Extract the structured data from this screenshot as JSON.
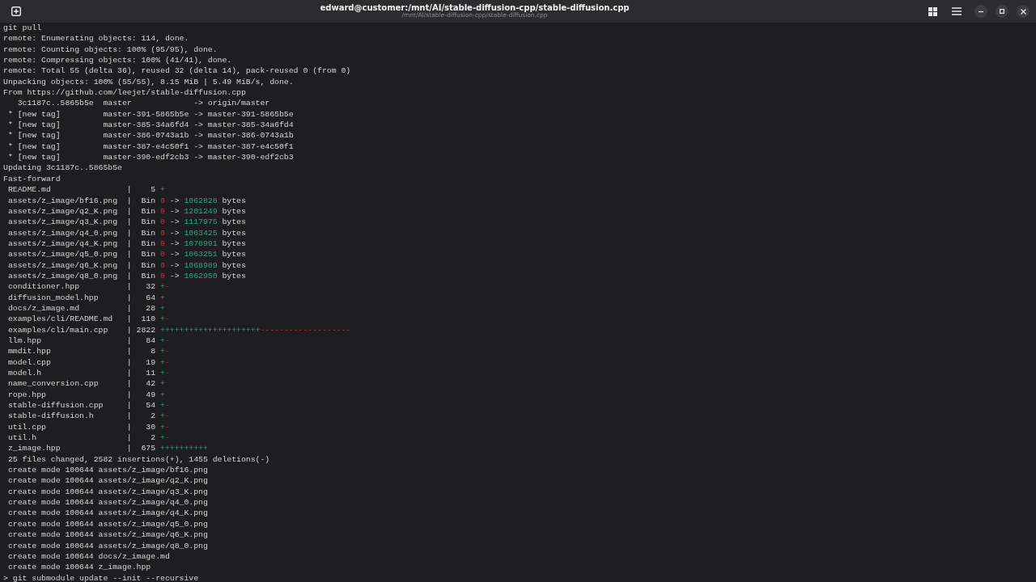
{
  "window": {
    "title": "edward@customer:/mnt/AI/stable-diffusion-cpp/stable-diffusion.cpp",
    "subtitle": "/mnt/AI/stable-diffusion-cpp/stable-diffusion.cpp"
  },
  "lines": [
    {
      "kind": "text",
      "text": "git pull"
    },
    {
      "kind": "text",
      "text": "remote: Enumerating objects: 114, done."
    },
    {
      "kind": "text",
      "text": "remote: Counting objects: 100% (95/95), done."
    },
    {
      "kind": "text",
      "text": "remote: Compressing objects: 100% (41/41), done."
    },
    {
      "kind": "text",
      "text": "remote: Total 55 (delta 36), reused 32 (delta 14), pack-reused 0 (from 0)"
    },
    {
      "kind": "text",
      "text": "Unpacking objects: 100% (55/55), 8.15 MiB | 5.49 MiB/s, done."
    },
    {
      "kind": "text",
      "text": "From https://github.com/leejet/stable-diffusion.cpp"
    },
    {
      "kind": "text",
      "text": "   3c1187c..5865b5e  master             -> origin/master"
    },
    {
      "kind": "text",
      "text": " * [new tag]         master-391-5865b5e -> master-391-5865b5e"
    },
    {
      "kind": "text",
      "text": " * [new tag]         master-385-34a6fd4 -> master-385-34a6fd4"
    },
    {
      "kind": "text",
      "text": " * [new tag]         master-386-0743a1b -> master-386-0743a1b"
    },
    {
      "kind": "text",
      "text": " * [new tag]         master-387-e4c50f1 -> master-387-e4c50f1"
    },
    {
      "kind": "text",
      "text": " * [new tag]         master-390-edf2cb3 -> master-390-edf2cb3"
    },
    {
      "kind": "text",
      "text": "Updating 3c1187c..5865b5e"
    },
    {
      "kind": "text",
      "text": "Fast-forward"
    },
    {
      "kind": "stat",
      "file": "README.md",
      "bar": "|",
      "count": "5",
      "plus": "+"
    },
    {
      "kind": "bin",
      "file": "assets/z_image/bf16.png",
      "bar": "|",
      "label": "Bin",
      "old": "0",
      "arrow": "->",
      "new": "1062828",
      "unit": "bytes"
    },
    {
      "kind": "bin",
      "file": "assets/z_image/q2_K.png",
      "bar": "|",
      "label": "Bin",
      "old": "0",
      "arrow": "->",
      "new": "1201249",
      "unit": "bytes"
    },
    {
      "kind": "bin",
      "file": "assets/z_image/q3_K.png",
      "bar": "|",
      "label": "Bin",
      "old": "0",
      "arrow": "->",
      "new": "1117975",
      "unit": "bytes"
    },
    {
      "kind": "bin",
      "file": "assets/z_image/q4_0.png",
      "bar": "|",
      "label": "Bin",
      "old": "0",
      "arrow": "->",
      "new": "1063425",
      "unit": "bytes"
    },
    {
      "kind": "bin",
      "file": "assets/z_image/q4_K.png",
      "bar": "|",
      "label": "Bin",
      "old": "0",
      "arrow": "->",
      "new": "1070991",
      "unit": "bytes"
    },
    {
      "kind": "bin",
      "file": "assets/z_image/q5_0.png",
      "bar": "|",
      "label": "Bin",
      "old": "0",
      "arrow": "->",
      "new": "1063251",
      "unit": "bytes"
    },
    {
      "kind": "bin",
      "file": "assets/z_image/q6_K.png",
      "bar": "|",
      "label": "Bin",
      "old": "0",
      "arrow": "->",
      "new": "1068989",
      "unit": "bytes"
    },
    {
      "kind": "bin",
      "file": "assets/z_image/q8_0.png",
      "bar": "|",
      "label": "Bin",
      "old": "0",
      "arrow": "->",
      "new": "1062950",
      "unit": "bytes"
    },
    {
      "kind": "stat",
      "file": "conditioner.hpp",
      "bar": "|",
      "count": "32",
      "plus": "+",
      "minus": "-"
    },
    {
      "kind": "stat",
      "file": "diffusion_model.hpp",
      "bar": "|",
      "count": "64",
      "plus": "+"
    },
    {
      "kind": "stat",
      "file": "docs/z_image.md",
      "bar": "|",
      "count": "28",
      "plus": "+"
    },
    {
      "kind": "stat",
      "file": "examples/cli/README.md",
      "bar": "|",
      "count": "110",
      "plus": "+",
      "minus": "-"
    },
    {
      "kind": "stat",
      "file": "examples/cli/main.cpp",
      "bar": "|",
      "count": "2822",
      "plus": "+++++++++++++++++++++",
      "minus": "-------------------"
    },
    {
      "kind": "stat",
      "file": "llm.hpp",
      "bar": "|",
      "count": "84",
      "plus": "+",
      "minus": "-"
    },
    {
      "kind": "stat",
      "file": "mmdit.hpp",
      "bar": "|",
      "count": "8",
      "plus": "+",
      "minus": "-"
    },
    {
      "kind": "stat",
      "file": "model.cpp",
      "bar": "|",
      "count": "19",
      "plus": "+",
      "minus": "-"
    },
    {
      "kind": "stat",
      "file": "model.h",
      "bar": "|",
      "count": "11",
      "plus": "+",
      "minus": "-"
    },
    {
      "kind": "stat",
      "file": "name_conversion.cpp",
      "bar": "|",
      "count": "42",
      "plus": "+"
    },
    {
      "kind": "stat",
      "file": "rope.hpp",
      "bar": "|",
      "count": "49",
      "plus": "+"
    },
    {
      "kind": "stat",
      "file": "stable-diffusion.cpp",
      "bar": "|",
      "count": "54",
      "plus": "+",
      "minus": "-"
    },
    {
      "kind": "stat",
      "file": "stable-diffusion.h",
      "bar": "|",
      "count": "2",
      "plus": "+",
      "minus": "-"
    },
    {
      "kind": "stat",
      "file": "util.cpp",
      "bar": "|",
      "count": "30",
      "plus": "+",
      "minus": "-"
    },
    {
      "kind": "stat",
      "file": "util.h",
      "bar": "|",
      "count": "2",
      "plus": "+",
      "minus": "-"
    },
    {
      "kind": "stat",
      "file": "z_image.hpp",
      "bar": "|",
      "count": "675",
      "plus": "++++++++++"
    },
    {
      "kind": "text",
      "text": " 25 files changed, 2582 insertions(+), 1455 deletions(-)"
    },
    {
      "kind": "text",
      "text": " create mode 100644 assets/z_image/bf16.png"
    },
    {
      "kind": "text",
      "text": " create mode 100644 assets/z_image/q2_K.png"
    },
    {
      "kind": "text",
      "text": " create mode 100644 assets/z_image/q3_K.png"
    },
    {
      "kind": "text",
      "text": " create mode 100644 assets/z_image/q4_0.png"
    },
    {
      "kind": "text",
      "text": " create mode 100644 assets/z_image/q4_K.png"
    },
    {
      "kind": "text",
      "text": " create mode 100644 assets/z_image/q5_0.png"
    },
    {
      "kind": "text",
      "text": " create mode 100644 assets/z_image/q6_K.png"
    },
    {
      "kind": "text",
      "text": " create mode 100644 assets/z_image/q8_0.png"
    },
    {
      "kind": "text",
      "text": " create mode 100644 docs/z_image.md"
    },
    {
      "kind": "text",
      "text": " create mode 100644 z_image.hpp"
    },
    {
      "kind": "prompt",
      "prompt": ">",
      "text": "git submodule update --init --recursive"
    }
  ]
}
